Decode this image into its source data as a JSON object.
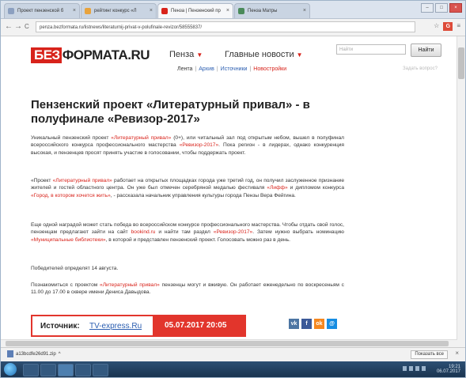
{
  "browser": {
    "tabs": [
      {
        "label": "Проект пензенской б",
        "favicon_color": "#8ca0c0",
        "active": false
      },
      {
        "label": "рейтинг конкурс «Л",
        "favicon_color": "#e8a33d",
        "active": false
      },
      {
        "label": "Пенза | Пензенский пр",
        "favicon_color": "#d8231b",
        "active": true
      },
      {
        "label": "Пенза Матры",
        "favicon_color": "#4a8a5a",
        "active": false
      }
    ],
    "url": "penza.bezformata.ru/listnews/literaturnij-privat-v-polufinale-revizor/58555837/",
    "back": "←",
    "forward": "→",
    "reload": "C",
    "home": "⌂",
    "star": "☆",
    "gplus": "G"
  },
  "site": {
    "logo_bez": "БЕЗ",
    "logo_rest": "ФОРМАТА.RU",
    "city": "Пенза",
    "news_menu": "Главные новости",
    "search_placeholder": "Найти",
    "search_button": "Найти",
    "subnav": [
      "Лента",
      "Архив",
      "Источники",
      "Новостройки"
    ],
    "report_link": "Задать вопрос?"
  },
  "article": {
    "headline": "Пензенский проект «Литературный привал» - в полуфинале «Ревизор-2017»",
    "p1_a": "Уникальный пензенский проект ",
    "p1_link1": "«Литературный привал»",
    "p1_b": " (0+), или читальный зал под открытым небом, вышел в полуфинал всероссийского конкурса профессионального мастерства ",
    "p1_link2": "«Ревизор-2017»",
    "p1_c": ". Пока регион - в лидерах, однако конкуренция высокая, и пензенцев просят принять участие в голосовании, чтобы поддержать проект.",
    "p2_a": "«Проект ",
    "p2_link1": "«Литературный привал»",
    "p2_b": " работает на открытых площадках города уже третий год, он получил заслуженное признание жителей и гостей областного центра. Он уже был отмечен серебряной медалью фестиваля ",
    "p2_link2": "«Лифф»",
    "p2_c": " и дипломом конкурса ",
    "p2_link3": "«Город, в котором хочется жить»",
    "p2_d": ", - рассказала начальник управления культуры города Пензы Вера Фейгина.",
    "p3_a": "Еще одной наградой может стать победа во всероссийском конкурсе профессионального мастерства. Чтобы отдать свой голос, пензенцам предлагают зайти на сайт ",
    "p3_link1": "bookind.ru",
    "p3_b": " и найти там раздел ",
    "p3_link2": "«Ревизор-2017»",
    "p3_c": ". Затем нужно выбрать номинацию ",
    "p3_link3": "«Муниципальные библиотеки»",
    "p3_d": ", в которой и представлен пензенский проект. Голосовать можно раз в день.",
    "p4": "Победителей определят 14 августа.",
    "p5_a": "Познакомиться с проектом ",
    "p5_link1": "«Литературный привал»",
    "p5_b": " пензенцы могут и вживую. Он работает еженедельно по воскресеньям с 11.00 до 17.00 в сквере имени Дениса Давыдова."
  },
  "source": {
    "label": "Источник:",
    "link": "TV-express.Ru",
    "date": "05.07.2017 20:05"
  },
  "share": {
    "vk": "vk",
    "fb": "f",
    "ok": "ok",
    "mail": "@"
  },
  "downloads": {
    "file": "a13bcdfe26d91.zip",
    "show_all": "Показать все",
    "close": "×"
  },
  "taskbar": {
    "time": "19:21",
    "date": "06.07.2017"
  },
  "colors": {
    "accent": "#d8231b",
    "link": "#2a5db0",
    "source_bg": "#e2352c"
  }
}
